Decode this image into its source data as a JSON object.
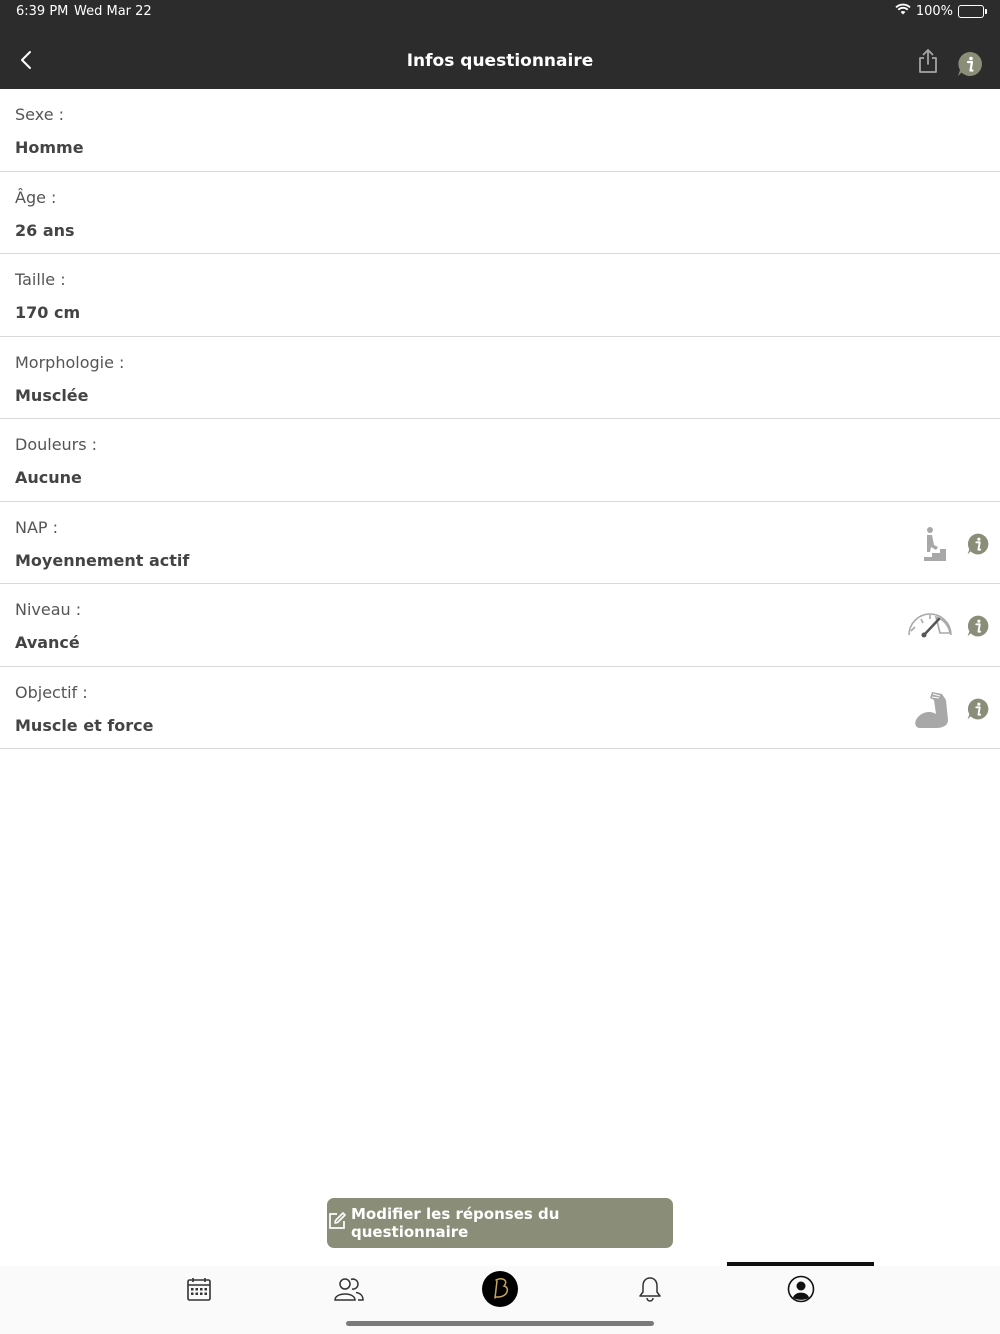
{
  "status_bar": {
    "time": "6:39 PM",
    "date": "Wed Mar 22",
    "battery": "100%",
    "battery_level": 1.0
  },
  "nav": {
    "title": "Infos questionnaire",
    "back_icon": "chevron-left-icon",
    "share_icon": "share-icon",
    "info_icon": "info-icon"
  },
  "rows": [
    {
      "label": "Sexe :",
      "value": "Homme"
    },
    {
      "label": "Âge :",
      "value": "26 ans"
    },
    {
      "label": "Taille :",
      "value": "170 cm"
    },
    {
      "label": "Morphologie :",
      "value": "Musclée"
    },
    {
      "label": "Douleurs :",
      "value": "Aucune"
    },
    {
      "label": "NAP :",
      "value": "Moyennement actif",
      "icon": "stairs-climber-icon"
    },
    {
      "label": "Niveau :",
      "value": "Avancé",
      "icon": "gauge-icon"
    },
    {
      "label": "Objectif :",
      "value": "Muscle et force",
      "icon": "flexed-arm-icon"
    }
  ],
  "edit_button": {
    "label": "Modifier les réponses du questionnaire",
    "icon": "edit-icon"
  },
  "tabs": [
    {
      "name": "calendar-icon",
      "selected": false
    },
    {
      "name": "users-icon",
      "selected": false
    },
    {
      "name": "brand-logo-icon",
      "selected": false
    },
    {
      "name": "bell-icon",
      "selected": false
    },
    {
      "name": "profile-icon",
      "selected": true
    }
  ],
  "colors": {
    "header_bg": "#2c2c2c",
    "accent": "#8a8d77",
    "icon_gray": "#a8a8a8"
  }
}
